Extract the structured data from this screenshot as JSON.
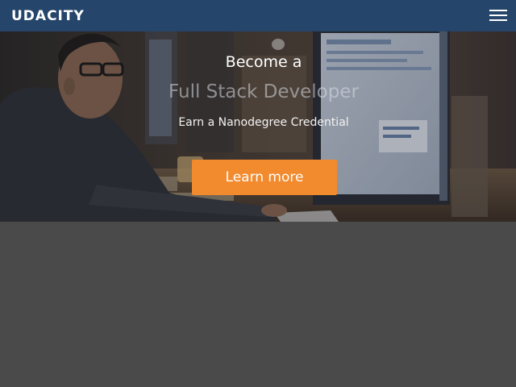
{
  "navbar": {
    "logo_text": "UDACITY",
    "menu_icon": "hamburger-menu-icon",
    "background_color": "#25456a"
  },
  "hero": {
    "line1": "Become a",
    "line2": "Full Stack Developer",
    "line3": "Earn a Nanodegree Credential",
    "cta_label": "Learn more",
    "cta_color": "#f28a2e"
  },
  "content": {
    "background_color": "#4a4a4a"
  }
}
